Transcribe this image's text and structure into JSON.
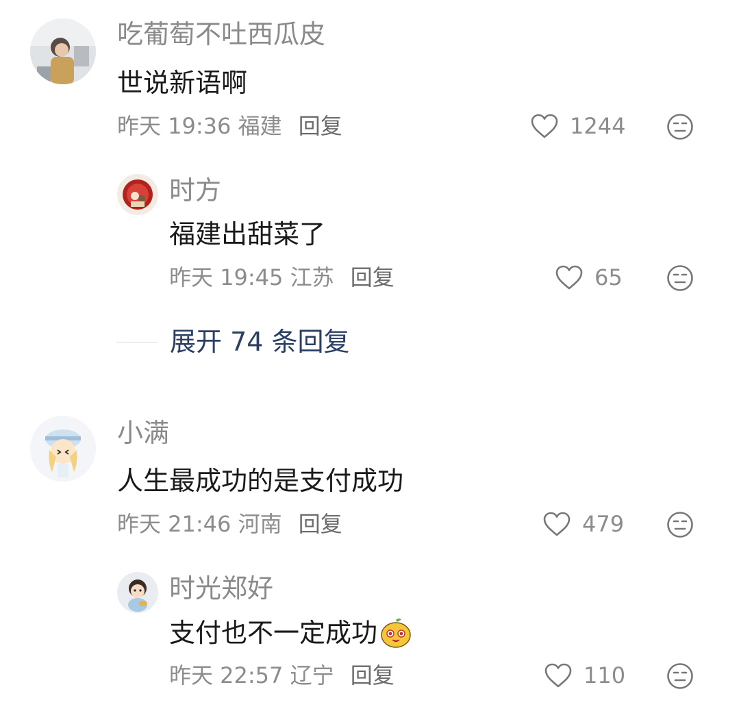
{
  "comments": [
    {
      "author": "吃葡萄不吐西瓜皮",
      "text": "世说新语啊",
      "time": "昨天 19:36",
      "location": "福建",
      "reply_label": "回复",
      "likes": "1244",
      "replies": [
        {
          "author": "时方",
          "text": "福建出甜菜了",
          "time": "昨天 19:45",
          "location": "江苏",
          "reply_label": "回复",
          "likes": "65"
        }
      ],
      "expand_label": "展开 74 条回复"
    },
    {
      "author": "小满",
      "text": "人生最成功的是支付成功",
      "time": "昨天 21:46",
      "location": "河南",
      "reply_label": "回复",
      "likes": "479",
      "replies": [
        {
          "author": "时光郑好",
          "text": "支付也不一定成功",
          "time": "昨天 22:57",
          "location": "辽宁",
          "reply_label": "回复",
          "likes": "110",
          "sticker": "yellow-mascot-sticker"
        }
      ]
    }
  ],
  "colors": {
    "author": "#8a8a8a",
    "content": "#1a1a1a",
    "meta": "#8c8c8c",
    "expand": "#2a3f63"
  },
  "icons": {
    "like": "heart-outline-icon",
    "dislike": "neutral-face-icon"
  }
}
